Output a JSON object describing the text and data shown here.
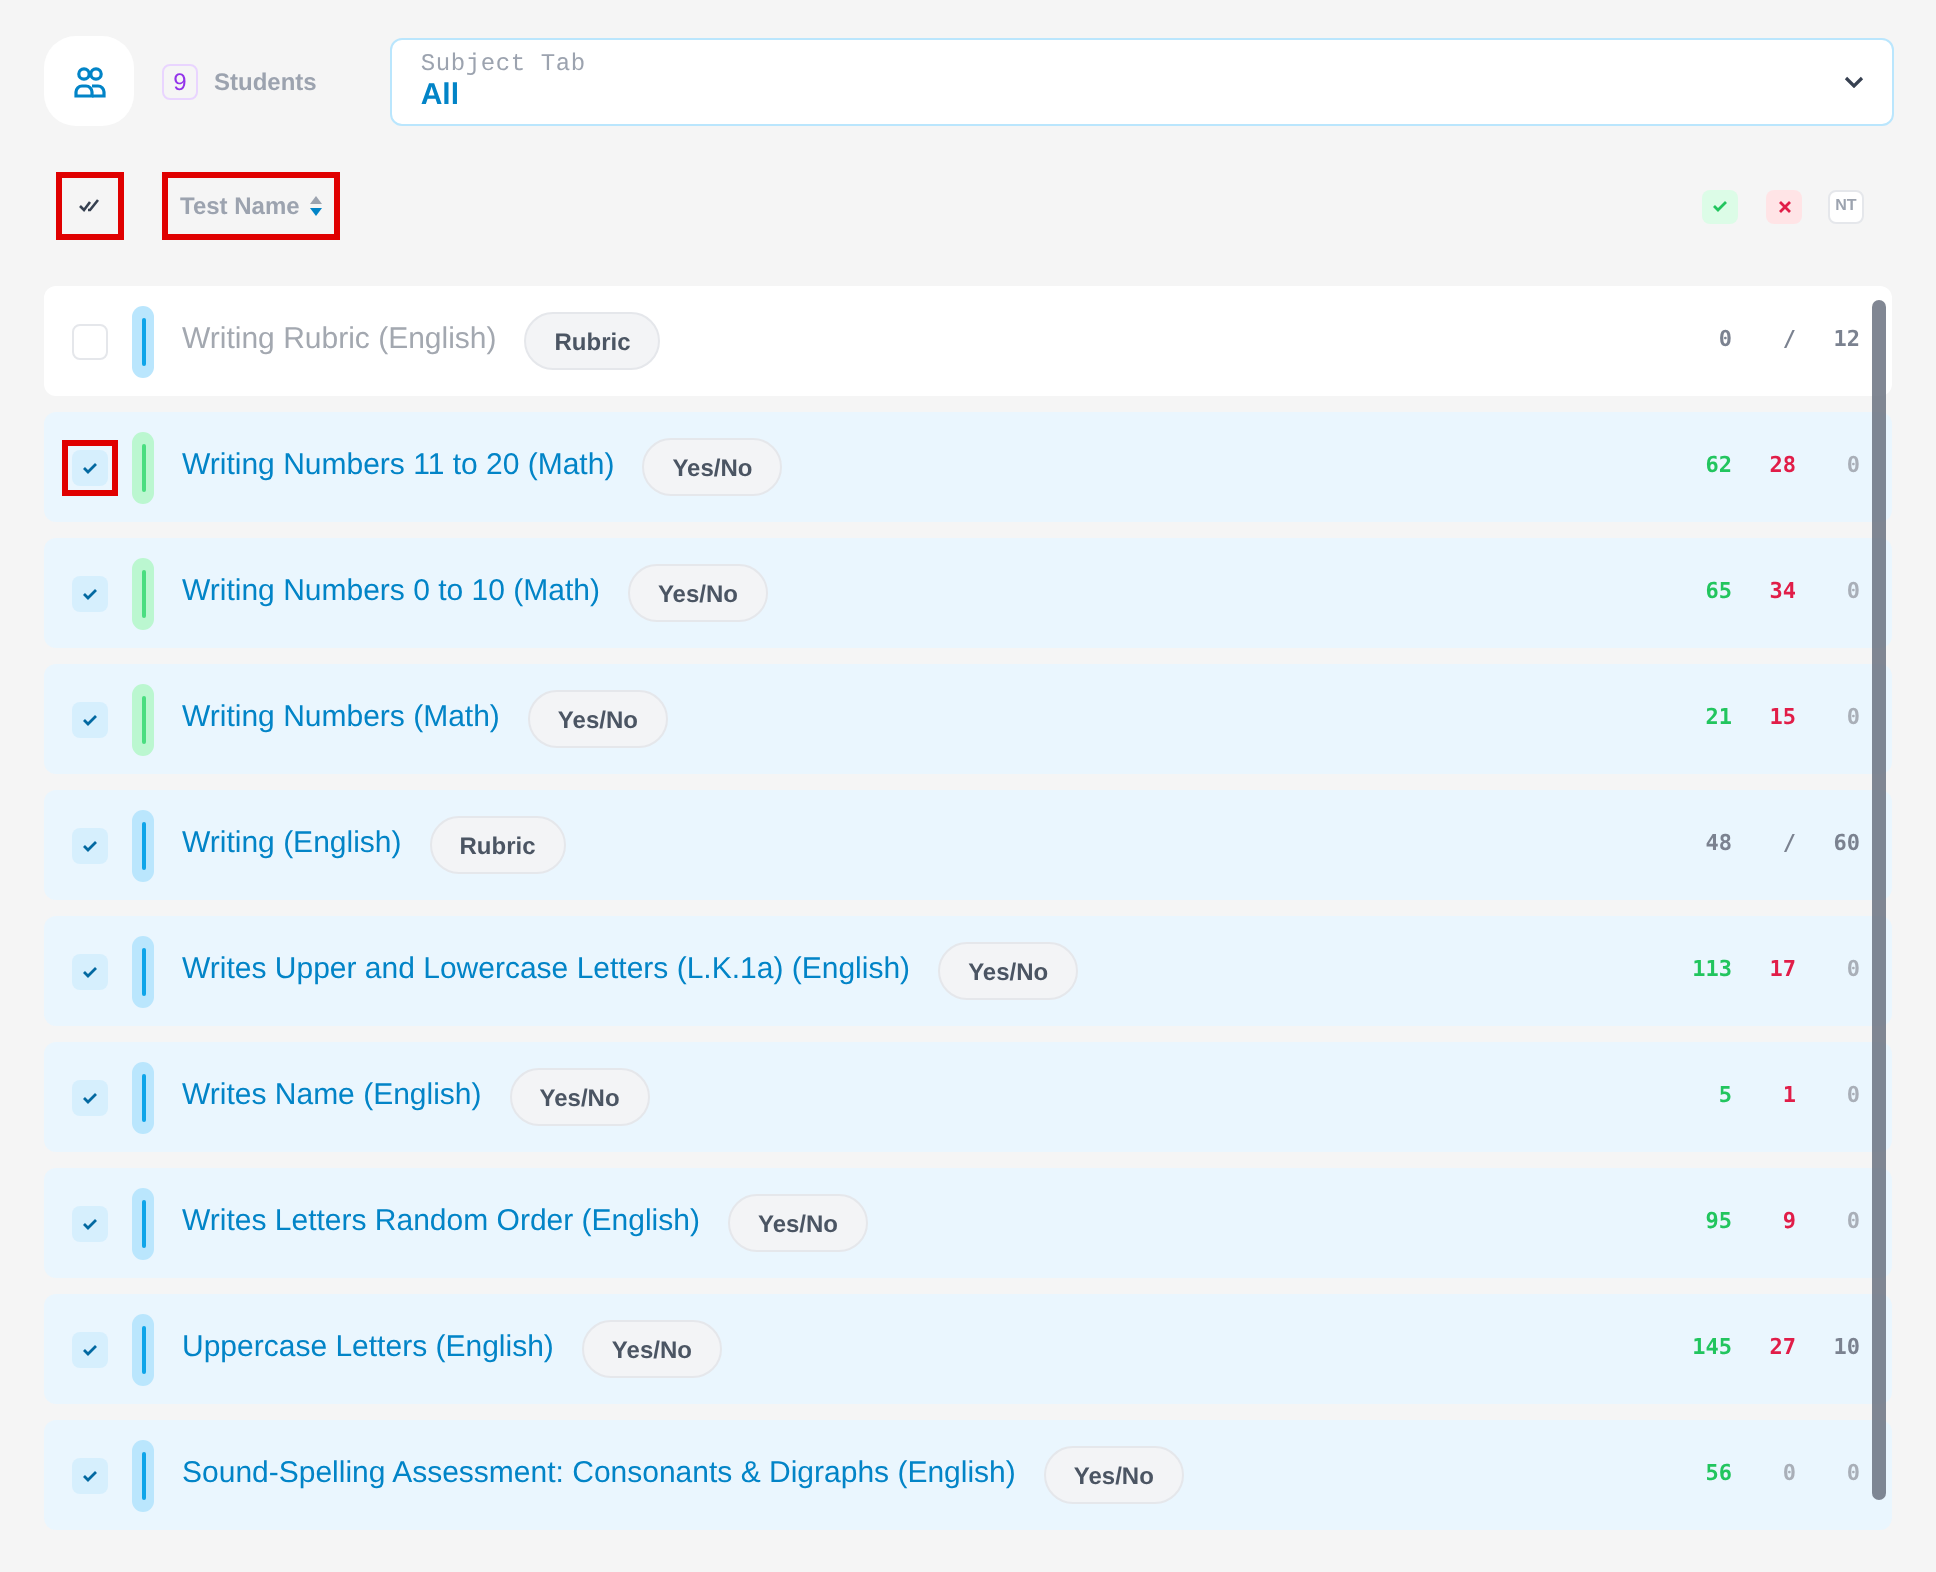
{
  "header": {
    "student_count": "9",
    "students_label": "Students",
    "subject": {
      "label": "Subject Tab",
      "value": "All"
    }
  },
  "toolbar": {
    "select_all": {
      "highlighted": true
    },
    "sort": {
      "label": "Test Name",
      "highlighted": true
    },
    "legend": {
      "nt": "NT"
    }
  },
  "tests": [
    {
      "name": "Writing Rubric (English)",
      "type": "Rubric",
      "kind": "rubric",
      "color": "#bae6fd",
      "checked": false,
      "disabled": true,
      "highlighted": false,
      "score": "0",
      "separator": "/",
      "total": "12"
    },
    {
      "name": "Writing Numbers 11 to 20 (Math)",
      "type": "Yes/No",
      "kind": "yesno",
      "color": "#bbf7d0",
      "checked": true,
      "disabled": false,
      "highlighted": true,
      "counts": [
        {
          "value": "62",
          "muted": false
        },
        {
          "value": "28",
          "muted": false
        },
        {
          "value": "0",
          "muted": true
        }
      ]
    },
    {
      "name": "Writing Numbers 0 to 10 (Math)",
      "type": "Yes/No",
      "kind": "yesno",
      "color": "#bbf7d0",
      "checked": true,
      "disabled": false,
      "highlighted": false,
      "counts": [
        {
          "value": "65",
          "muted": false
        },
        {
          "value": "34",
          "muted": false
        },
        {
          "value": "0",
          "muted": true
        }
      ]
    },
    {
      "name": "Writing Numbers (Math)",
      "type": "Yes/No",
      "kind": "yesno",
      "color": "#bbf7d0",
      "checked": true,
      "disabled": false,
      "highlighted": false,
      "counts": [
        {
          "value": "21",
          "muted": false
        },
        {
          "value": "15",
          "muted": false
        },
        {
          "value": "0",
          "muted": true
        }
      ]
    },
    {
      "name": "Writing (English)",
      "type": "Rubric",
      "kind": "rubric",
      "color": "#bae6fd",
      "checked": true,
      "disabled": false,
      "highlighted": false,
      "score": "48",
      "separator": "/",
      "total": "60"
    },
    {
      "name": "Writes Upper and Lowercase Letters (L.K.1a) (English)",
      "type": "Yes/No",
      "kind": "yesno",
      "color": "#bae6fd",
      "checked": true,
      "disabled": false,
      "highlighted": false,
      "counts": [
        {
          "value": "113",
          "muted": false
        },
        {
          "value": "17",
          "muted": false
        },
        {
          "value": "0",
          "muted": true
        }
      ]
    },
    {
      "name": "Writes Name (English)",
      "type": "Yes/No",
      "kind": "yesno",
      "color": "#bae6fd",
      "checked": true,
      "disabled": false,
      "highlighted": false,
      "counts": [
        {
          "value": "5",
          "muted": false
        },
        {
          "value": "1",
          "muted": false
        },
        {
          "value": "0",
          "muted": true
        }
      ]
    },
    {
      "name": "Writes Letters Random Order (English)",
      "type": "Yes/No",
      "kind": "yesno",
      "color": "#bae6fd",
      "checked": true,
      "disabled": false,
      "highlighted": false,
      "counts": [
        {
          "value": "95",
          "muted": false
        },
        {
          "value": "9",
          "muted": false
        },
        {
          "value": "0",
          "muted": true
        }
      ]
    },
    {
      "name": "Uppercase Letters (English)",
      "type": "Yes/No",
      "kind": "yesno",
      "color": "#bae6fd",
      "checked": true,
      "disabled": false,
      "highlighted": false,
      "counts": [
        {
          "value": "145",
          "muted": false
        },
        {
          "value": "27",
          "muted": false
        },
        {
          "value": "10",
          "muted": false
        }
      ]
    },
    {
      "name": "Sound-Spelling Assessment: Consonants & Digraphs (English)",
      "type": "Yes/No",
      "kind": "yesno",
      "color": "#bae6fd",
      "checked": true,
      "disabled": false,
      "highlighted": false,
      "counts": [
        {
          "value": "56",
          "muted": false
        },
        {
          "value": "0",
          "muted": true
        },
        {
          "value": "0",
          "muted": true
        }
      ]
    }
  ]
}
